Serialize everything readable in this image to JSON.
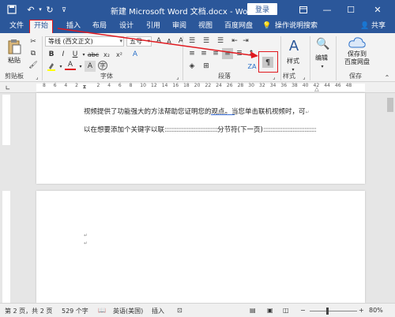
{
  "titlebar": {
    "title": "新建 Microsoft Word 文档.docx - Word",
    "login": "登录"
  },
  "tabs": [
    {
      "label": "文件"
    },
    {
      "label": "开始"
    },
    {
      "label": "插入"
    },
    {
      "label": "布局"
    },
    {
      "label": "设计"
    },
    {
      "label": "引用"
    },
    {
      "label": "审阅"
    },
    {
      "label": "视图"
    },
    {
      "label": "百度网盘"
    },
    {
      "label": "操作说明搜索"
    }
  ],
  "share": "共享",
  "ribbon": {
    "paste": "粘贴",
    "clipboard": "剪贴板",
    "font_name": "等线 (西文正文)",
    "font_size": "五号",
    "font_group": "字体",
    "paragraph_group": "段落",
    "styles": "样式",
    "styles_group": "样式",
    "editing": "编辑",
    "save_to_baidu": "保存到\n百度网盘",
    "save_group": "保存"
  },
  "ruler_numbers": [
    "8",
    "6",
    "4",
    "2",
    "",
    "2",
    "4",
    "6",
    "8",
    "10",
    "12",
    "14",
    "16",
    "18",
    "20",
    "22",
    "24",
    "26",
    "28",
    "30",
    "32",
    "34",
    "36",
    "38",
    "40",
    "42",
    "44",
    "46",
    "48"
  ],
  "document": {
    "line1": "视频提供了功能强大的方法帮助您证明您的观点。当您单击联机视频时，可",
    "line2_text": "以在想要添加个关键字以联",
    "section_break": "分节符(下一页)"
  },
  "statusbar": {
    "page": "第 2 页，共 2 页",
    "words": "529 个字",
    "language": "英语(美国)",
    "mode": "插入",
    "zoom": "80%"
  }
}
